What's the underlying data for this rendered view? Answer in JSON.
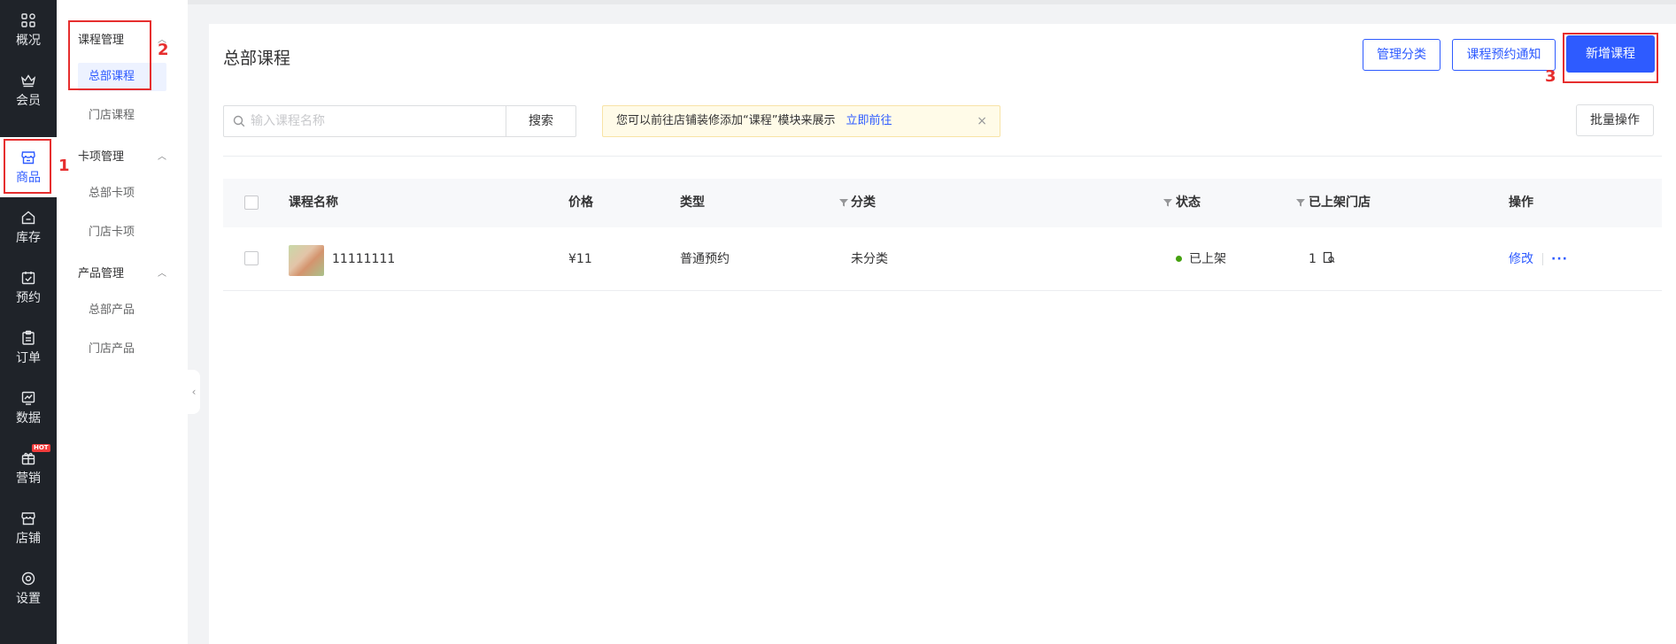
{
  "rail": {
    "items": [
      {
        "label": "概况",
        "icon": "grid-icon"
      },
      {
        "label": "会员",
        "icon": "crown-icon"
      },
      {
        "label": "商品",
        "icon": "shop-icon"
      },
      {
        "label": "库存",
        "icon": "home-icon"
      },
      {
        "label": "预约",
        "icon": "calendar-check-icon"
      },
      {
        "label": "订单",
        "icon": "clipboard-icon"
      },
      {
        "label": "数据",
        "icon": "chart-icon"
      },
      {
        "label": "营销",
        "icon": "gift-icon",
        "badge": "HOT"
      },
      {
        "label": "店铺",
        "icon": "store-icon"
      },
      {
        "label": "设置",
        "icon": "gear-icon"
      }
    ],
    "active": "商品"
  },
  "subnav": {
    "groups": [
      {
        "title": "课程管理",
        "items": [
          "总部课程",
          "门店课程"
        ]
      },
      {
        "title": "卡项管理",
        "items": [
          "总部卡项",
          "门店卡项"
        ]
      },
      {
        "title": "产品管理",
        "items": [
          "总部产品",
          "门店产品"
        ]
      }
    ],
    "active": "总部课程"
  },
  "page": {
    "title": "总部课程",
    "buttons": {
      "manage_category": "管理分类",
      "booking_notice": "课程预约通知",
      "add_course": "新增课程",
      "batch": "批量操作"
    },
    "search": {
      "placeholder": "输入课程名称",
      "button": "搜索"
    },
    "notice": {
      "text": "您可以前往店铺装修添加“课程”模块来展示",
      "link": "立即前往",
      "close": "×"
    }
  },
  "table": {
    "columns": [
      "课程名称",
      "价格",
      "类型",
      "分类",
      "状态",
      "已上架门店",
      "操作"
    ],
    "rows": [
      {
        "name": "11111111",
        "price": "¥11",
        "type": "普通预约",
        "category": "未分类",
        "status": "已上架",
        "stores": "1",
        "action_edit": "修改",
        "action_more": "···"
      }
    ]
  },
  "annotations": [
    "1",
    "2",
    "3"
  ],
  "colors": {
    "primary": "#2e5bff",
    "rail_bg": "#1f2329",
    "status_green": "#45a110",
    "annotation_red": "#e62e2e",
    "hot_badge": "#f23c3c"
  }
}
